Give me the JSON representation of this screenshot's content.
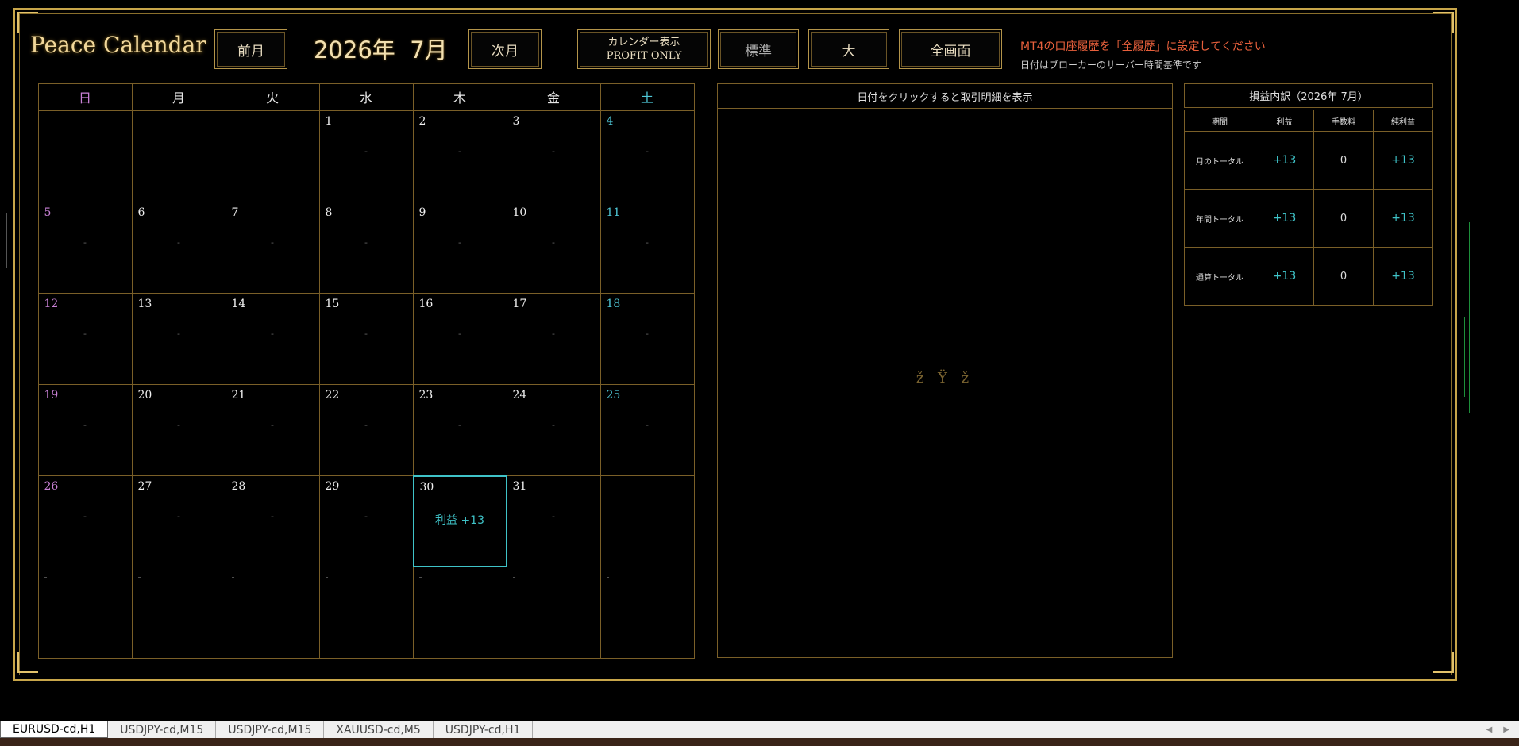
{
  "app_title": "Peace Calendar",
  "nav": {
    "prev": "前月",
    "next": "次月",
    "month_title": "2026年  7月"
  },
  "display_btn": {
    "line1": "カレンダー表示",
    "line2": "PROFIT ONLY"
  },
  "size_buttons": {
    "standard": "標準",
    "large": "大",
    "fullscreen": "全画面"
  },
  "warning": "MT4の口座履歴を「全履歴」に設定してください",
  "note": "日付はブローカーのサーバー時間基準です",
  "weekdays": [
    "日",
    "月",
    "火",
    "水",
    "木",
    "金",
    "土"
  ],
  "weekday_colors": {
    "sun": "#c981d6",
    "sat": "#4fc8d8",
    "accent": "#3fc3c8",
    "gold": "#c8a64a"
  },
  "calendar_rows": [
    [
      {
        "d": "-",
        "off": true
      },
      {
        "d": "-",
        "off": true
      },
      {
        "d": "-",
        "off": true
      },
      {
        "d": "1",
        "v": "-"
      },
      {
        "d": "2",
        "v": "-"
      },
      {
        "d": "3",
        "v": "-"
      },
      {
        "d": "4",
        "v": "-"
      }
    ],
    [
      {
        "d": "5",
        "v": "-"
      },
      {
        "d": "6",
        "v": "-"
      },
      {
        "d": "7",
        "v": "-"
      },
      {
        "d": "8",
        "v": "-"
      },
      {
        "d": "9",
        "v": "-"
      },
      {
        "d": "10",
        "v": "-"
      },
      {
        "d": "11",
        "v": "-"
      }
    ],
    [
      {
        "d": "12",
        "v": "-"
      },
      {
        "d": "13",
        "v": "-"
      },
      {
        "d": "14",
        "v": "-"
      },
      {
        "d": "15",
        "v": "-"
      },
      {
        "d": "16",
        "v": "-"
      },
      {
        "d": "17",
        "v": "-"
      },
      {
        "d": "18",
        "v": "-"
      }
    ],
    [
      {
        "d": "19",
        "v": "-"
      },
      {
        "d": "20",
        "v": "-"
      },
      {
        "d": "21",
        "v": "-"
      },
      {
        "d": "22",
        "v": "-"
      },
      {
        "d": "23",
        "v": "-"
      },
      {
        "d": "24",
        "v": "-"
      },
      {
        "d": "25",
        "v": "-"
      }
    ],
    [
      {
        "d": "26",
        "v": "-"
      },
      {
        "d": "27",
        "v": "-"
      },
      {
        "d": "28",
        "v": "-"
      },
      {
        "d": "29",
        "v": "-"
      },
      {
        "d": "30",
        "profit": "利益 +13",
        "highlight": true
      },
      {
        "d": "31",
        "v": "-"
      },
      {
        "d": "-",
        "off": true
      }
    ],
    [
      {
        "d": "-",
        "off": true
      },
      {
        "d": "-",
        "off": true
      },
      {
        "d": "-",
        "off": true
      },
      {
        "d": "-",
        "off": true
      },
      {
        "d": "-",
        "off": true
      },
      {
        "d": "-",
        "off": true
      },
      {
        "d": "-",
        "off": true
      }
    ]
  ],
  "detail": {
    "header": "日付をクリックすると取引明細を表示",
    "placeholder": "ž Ÿ ž"
  },
  "summary": {
    "title": "損益内訳（2026年 7月）",
    "columns": [
      "期間",
      "利益",
      "手数料",
      "純利益"
    ],
    "rows": [
      {
        "label": "月のトータル",
        "profit": "+13",
        "fee": "0",
        "net": "+13"
      },
      {
        "label": "年間トータル",
        "profit": "+13",
        "fee": "0",
        "net": "+13"
      },
      {
        "label": "通算トータル",
        "profit": "+13",
        "fee": "0",
        "net": "+13"
      }
    ]
  },
  "tabs": [
    "EURUSD-cd,H1",
    "USDJPY-cd,M15",
    "USDJPY-cd,M15",
    "XAUUSD-cd,M5",
    "USDJPY-cd,H1"
  ],
  "tab_arrows": {
    "left": "◀",
    "right": "▶"
  }
}
